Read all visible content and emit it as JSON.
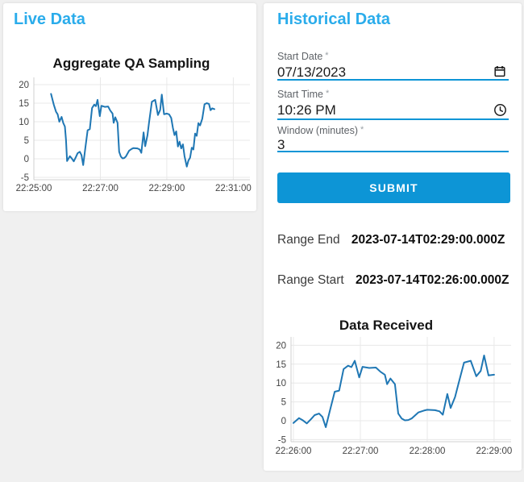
{
  "page": {
    "colors": {
      "accent": "#2aaceb",
      "primary": "#0d95d6",
      "grid": "#e8e8e8"
    }
  },
  "live_panel": {
    "title": "Live Data"
  },
  "historical_panel": {
    "title": "Historical Data",
    "fields": [
      {
        "label": "Start Date",
        "required": "*",
        "value": "07/13/2023",
        "icon": "calendar-icon"
      },
      {
        "label": "Start Time",
        "required": "*",
        "value": "10:26 PM",
        "icon": "clock-icon"
      },
      {
        "label": "Window (minutes)",
        "required": "*",
        "value": "3",
        "icon": ""
      }
    ],
    "submit_label": "SUBMIT",
    "results": [
      {
        "label": "Range End",
        "value": "2023-07-14T02:29:00.000Z"
      },
      {
        "label": "Range Start",
        "value": "2023-07-14T02:26:00.000Z"
      }
    ]
  },
  "chart_data": [
    {
      "id": "live",
      "type": "line",
      "title": "Aggregate QA Sampling",
      "x_unit": "seconds after 22:25:00",
      "xticks": {
        "seconds": [
          0,
          120,
          240,
          360
        ],
        "labels": [
          "22:25:00",
          "22:27:00",
          "22:29:00",
          "22:31:00"
        ]
      },
      "yticks": [
        -5,
        0,
        5,
        10,
        15,
        20
      ],
      "ylim": [
        -5.5,
        21.5
      ],
      "xlim": [
        0,
        390
      ],
      "grid": true,
      "legend": false,
      "line_color": "#1f77b4",
      "x": [
        31,
        36,
        40,
        43,
        46,
        50,
        53,
        56,
        58,
        60,
        65,
        68,
        72,
        76,
        79,
        83,
        86,
        89,
        93,
        97,
        101,
        105,
        109,
        112,
        115,
        119,
        122,
        128,
        134,
        138,
        142,
        144,
        147,
        151,
        154,
        157,
        160,
        163,
        166,
        172,
        177,
        180,
        187,
        191,
        194,
        198,
        201,
        205,
        208,
        213,
        219,
        224,
        228,
        231,
        235,
        240,
        244,
        248,
        251,
        254,
        257,
        260,
        263,
        266,
        269,
        272,
        276,
        279,
        282,
        285,
        288,
        291,
        294,
        297,
        300,
        304,
        308,
        312,
        316,
        319,
        322,
        326
      ],
      "values": [
        17.5,
        14.6,
        12.7,
        12.0,
        10.0,
        11.3,
        9.7,
        8.7,
        5.0,
        -0.6,
        0.7,
        0.2,
        -0.7,
        0.5,
        1.5,
        1.9,
        1.0,
        -1.7,
        3.0,
        7.7,
        8.0,
        13.7,
        14.6,
        14.2,
        15.9,
        11.5,
        14.3,
        14.0,
        14.1,
        13.0,
        12.2,
        9.7,
        11.2,
        9.7,
        1.9,
        0.6,
        0.1,
        0.2,
        0.6,
        2.2,
        2.7,
        2.9,
        2.8,
        2.5,
        1.6,
        7.1,
        3.4,
        6.3,
        9.8,
        15.4,
        15.9,
        11.8,
        13.2,
        17.3,
        12.0,
        12.2,
        12.0,
        11.0,
        8.3,
        6.4,
        7.4,
        3.3,
        4.6,
        2.8,
        3.9,
        0.7,
        -2.1,
        -0.5,
        0.3,
        3.0,
        2.5,
        6.8,
        6.2,
        9.6,
        9.0,
        10.8,
        14.7,
        15.0,
        14.8,
        13.1,
        13.6,
        13.4
      ]
    },
    {
      "id": "historical",
      "type": "line",
      "title": "Data Received",
      "x_unit": "seconds after 22:26:00",
      "xticks": {
        "seconds": [
          0,
          60,
          120,
          180
        ],
        "labels": [
          "22:26:00",
          "22:27:00",
          "22:28:00",
          "22:29:00"
        ]
      },
      "yticks": [
        -5,
        0,
        5,
        10,
        15,
        20
      ],
      "ylim": [
        -5.5,
        21.8
      ],
      "xlim": [
        -2,
        196
      ],
      "grid": true,
      "legend": false,
      "line_color": "#1f77b4",
      "x": [
        0,
        5,
        8,
        12,
        16,
        19,
        23,
        26,
        29,
        33,
        37,
        41,
        45,
        49,
        52,
        55,
        59,
        62,
        68,
        74,
        78,
        82,
        84,
        87,
        91,
        94,
        97,
        100,
        103,
        106,
        112,
        117,
        120,
        127,
        131,
        134,
        138,
        141,
        145,
        148,
        153,
        159,
        164,
        168,
        171,
        175,
        180
      ],
      "values": [
        -0.6,
        0.7,
        0.2,
        -0.7,
        0.5,
        1.5,
        1.9,
        1.0,
        -1.7,
        3.0,
        7.7,
        8.0,
        13.7,
        14.6,
        14.2,
        15.9,
        11.5,
        14.3,
        14.0,
        14.1,
        13.0,
        12.2,
        9.7,
        11.2,
        9.7,
        1.9,
        0.6,
        0.1,
        0.2,
        0.6,
        2.2,
        2.7,
        2.9,
        2.8,
        2.5,
        1.6,
        7.1,
        3.4,
        6.3,
        9.8,
        15.4,
        15.9,
        11.8,
        13.2,
        17.3,
        12.0,
        12.2
      ]
    }
  ]
}
